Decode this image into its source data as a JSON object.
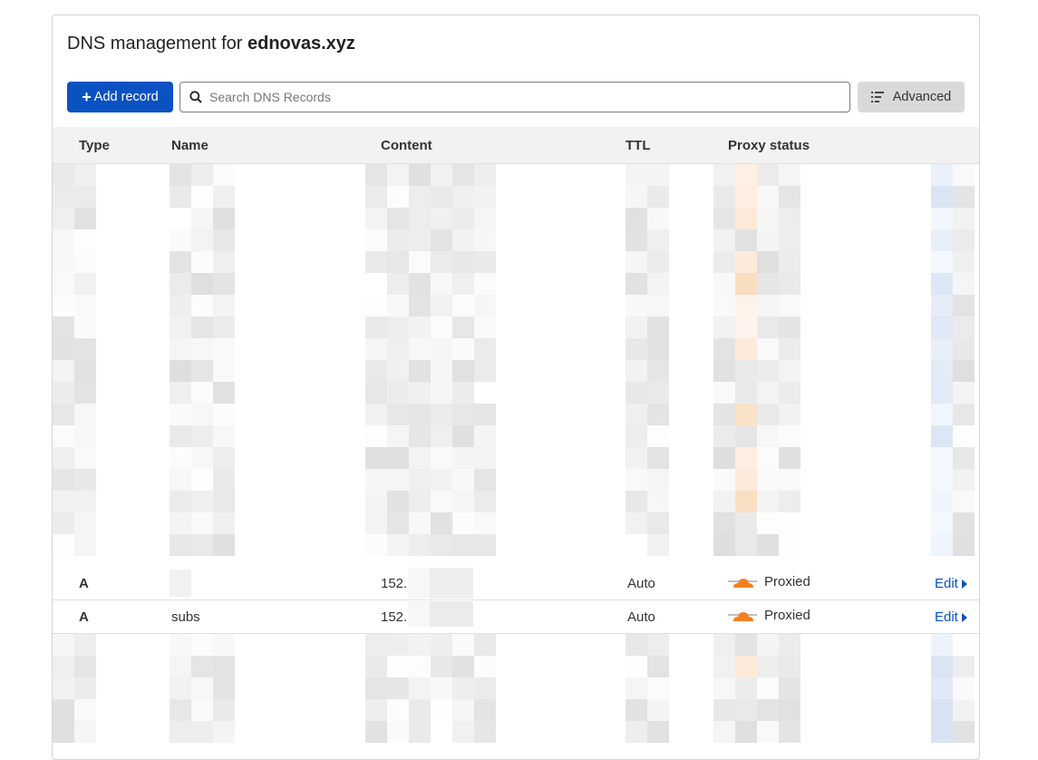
{
  "header": {
    "title_prefix": "DNS management for ",
    "domain": "ednovas.xyz"
  },
  "toolbar": {
    "add_record_label": "Add record",
    "search_placeholder": "Search DNS Records",
    "advanced_label": "Advanced"
  },
  "table": {
    "columns": [
      "Type",
      "Name",
      "Content",
      "TTL",
      "Proxy status"
    ],
    "rows": [
      {
        "type": "A",
        "name": "",
        "content": "152.",
        "ttl": "Auto",
        "proxy": "Proxied",
        "edit": "Edit"
      },
      {
        "type": "A",
        "name": "subs",
        "content": "152.",
        "ttl": "Auto",
        "proxy": "Proxied",
        "edit": "Edit"
      }
    ]
  },
  "colors": {
    "primary": "#0a51c2",
    "cloud_orange": "#f38020",
    "header_bg": "#f2f2f2"
  },
  "icons": {
    "add": "plus-icon",
    "search": "search-icon",
    "advanced": "filter-list-icon",
    "proxy": "cloud-icon",
    "edit": "caret-right-icon"
  }
}
